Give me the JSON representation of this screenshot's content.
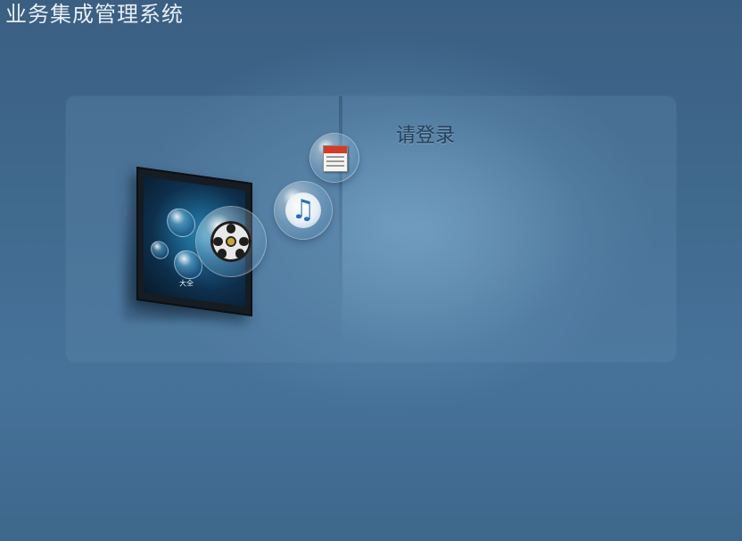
{
  "app": {
    "title": "业务集成管理系统"
  },
  "login": {
    "heading": "请登录"
  },
  "illustration": {
    "tv_screen_label": "大全",
    "icons": [
      "film-reel-icon",
      "music-note-icon",
      "newspaper-icon"
    ]
  },
  "colors": {
    "background": "#416a8f",
    "title_text": "#e8eef5",
    "heading_text": "#24405c"
  }
}
